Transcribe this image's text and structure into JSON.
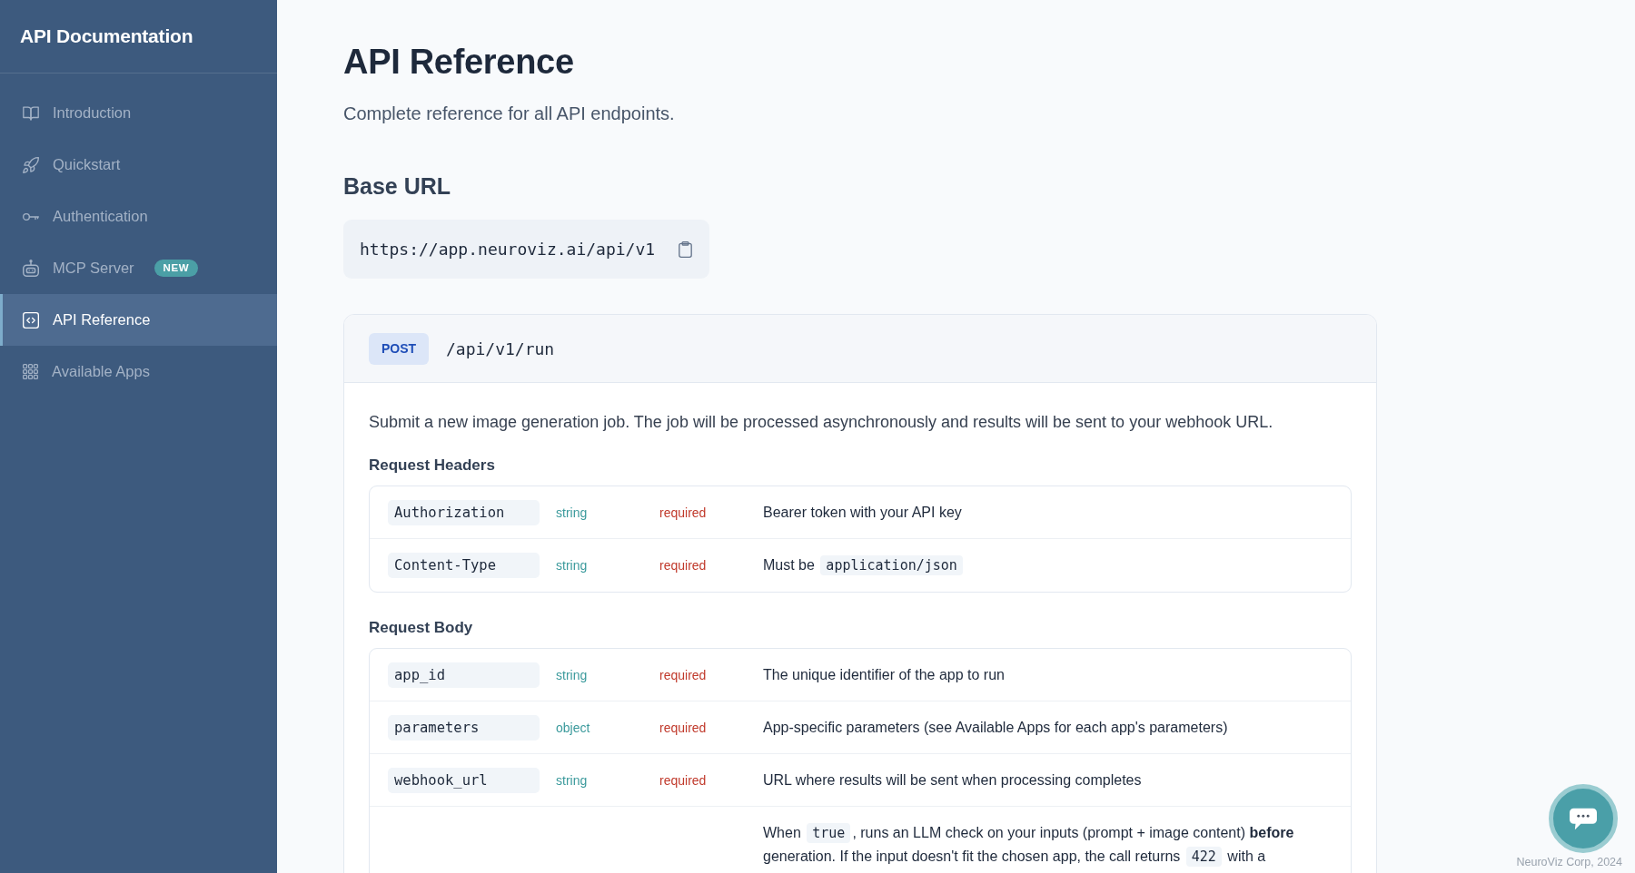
{
  "sidebar": {
    "title": "API Documentation",
    "items": [
      {
        "label": "Introduction",
        "selected": false
      },
      {
        "label": "Quickstart",
        "selected": false
      },
      {
        "label": "Authentication",
        "selected": false
      },
      {
        "label": "MCP Server",
        "selected": false,
        "badge": "NEW"
      },
      {
        "label": "API Reference",
        "selected": true
      },
      {
        "label": "Available Apps",
        "selected": false
      }
    ]
  },
  "page": {
    "title": "API Reference",
    "subtitle": "Complete reference for all API endpoints."
  },
  "base_url": {
    "heading": "Base URL",
    "url": "https://app.neuroviz.ai/api/v1"
  },
  "endpoint": {
    "method": "POST",
    "path": "/api/v1/run",
    "description": "Submit a new image generation job. The job will be processed asynchronously and results will be sent to your webhook URL.",
    "sections": [
      {
        "heading": "Request Headers",
        "rows": [
          {
            "name": "Authorization",
            "type": "string",
            "requirement": "required",
            "description": [
              {
                "kind": "text",
                "text": "Bearer token with your API key"
              }
            ]
          },
          {
            "name": "Content-Type",
            "type": "string",
            "requirement": "required",
            "description": [
              {
                "kind": "text",
                "text": "Must be "
              },
              {
                "kind": "code",
                "text": "application/json"
              }
            ]
          }
        ]
      },
      {
        "heading": "Request Body",
        "rows": [
          {
            "name": "app_id",
            "type": "string",
            "requirement": "required",
            "description": [
              {
                "kind": "text",
                "text": "The unique identifier of the app to run"
              }
            ]
          },
          {
            "name": "parameters",
            "type": "object",
            "requirement": "required",
            "description": [
              {
                "kind": "text",
                "text": "App-specific parameters (see Available Apps for each app's parameters)"
              }
            ]
          },
          {
            "name": "webhook_url",
            "type": "string",
            "requirement": "required",
            "description": [
              {
                "kind": "text",
                "text": "URL where results will be sent when processing completes"
              }
            ]
          },
          {
            "description": [
              {
                "kind": "text",
                "text": "When "
              },
              {
                "kind": "code",
                "text": "true"
              },
              {
                "kind": "text",
                "text": ", runs an LLM check on your inputs (prompt + image content) **before** generation. If the input doesn't fit the chosen app, the call returns "
              },
              {
                "kind": "code",
                "text": "422"
              },
              {
                "kind": "text",
                "text": " with a"
              }
            ]
          }
        ]
      }
    ]
  },
  "footer": {
    "copyright": "NeuroViz Corp, 2024"
  }
}
